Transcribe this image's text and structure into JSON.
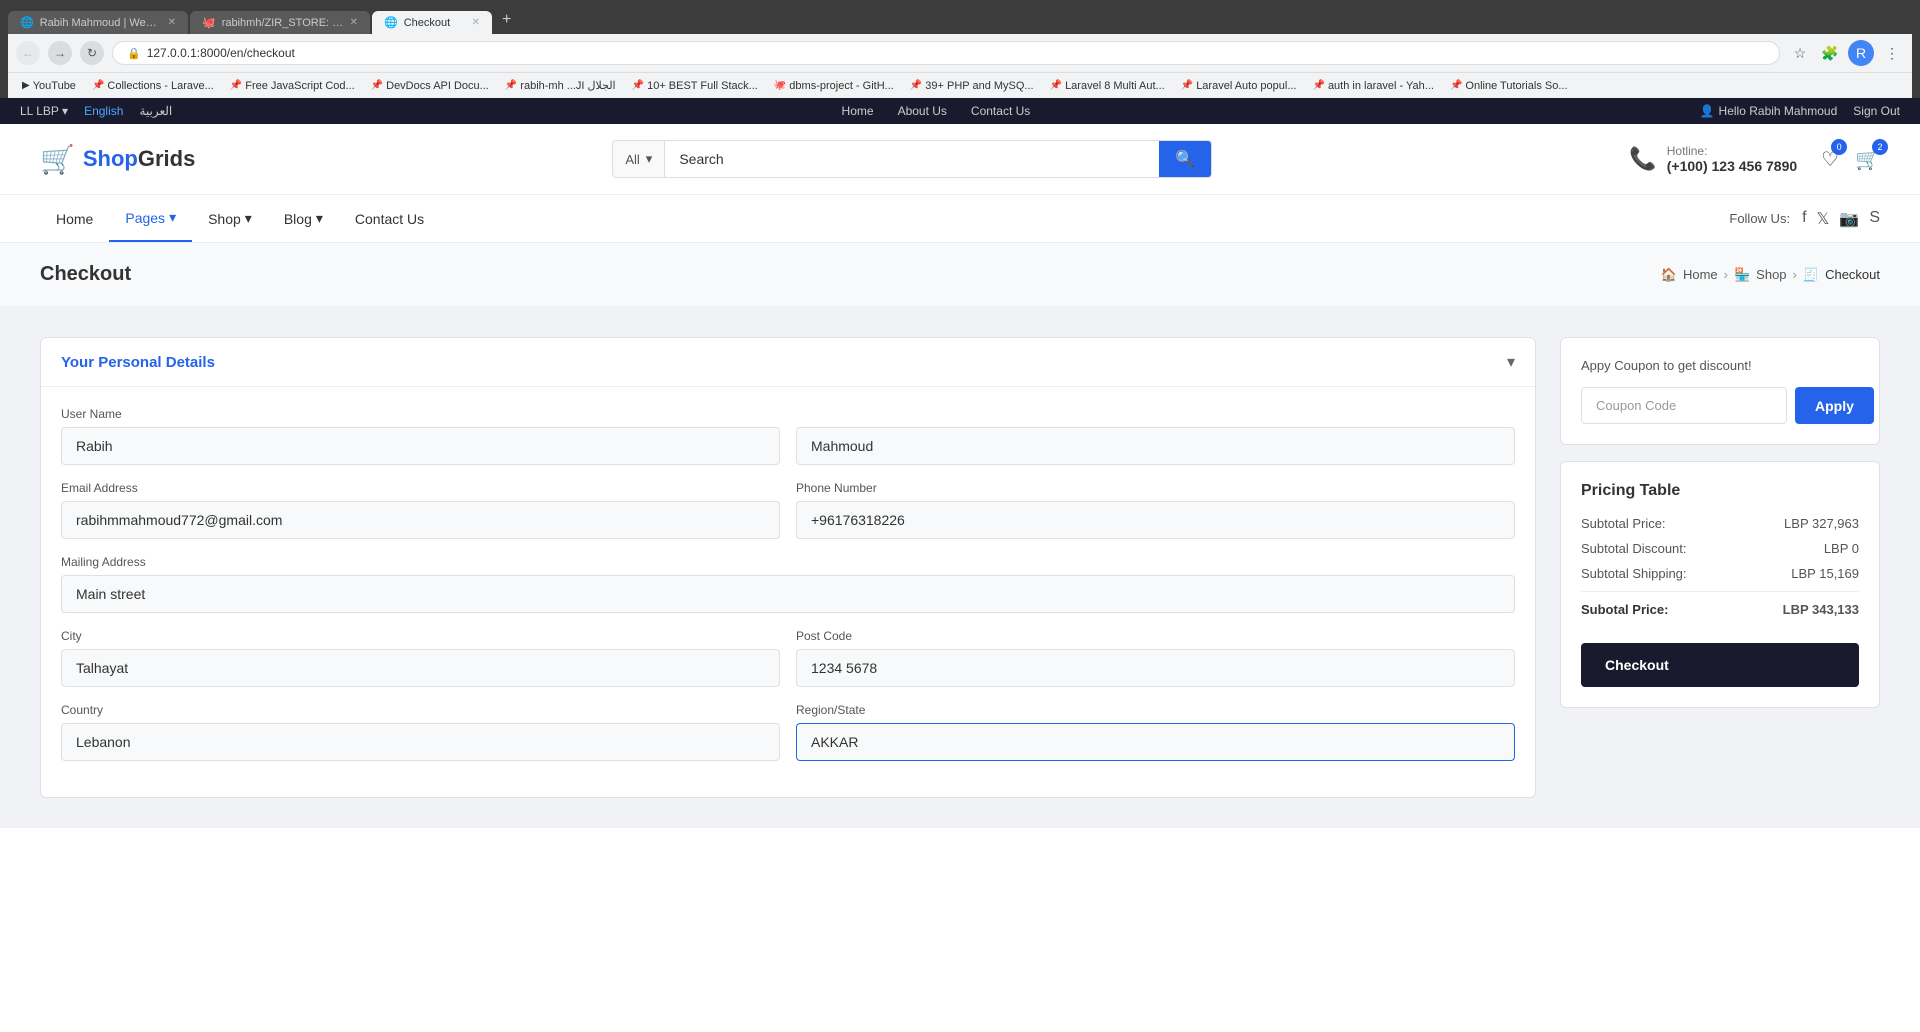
{
  "browser": {
    "tabs": [
      {
        "id": "tab1",
        "title": "Rabih Mahmoud | Web Develop...",
        "active": false,
        "favicon": "🌐"
      },
      {
        "id": "tab2",
        "title": "rabihmh/ZIR_STORE: Multi vend...",
        "active": false,
        "favicon": "🐙"
      },
      {
        "id": "tab3",
        "title": "Checkout",
        "active": true,
        "favicon": "🌐"
      }
    ],
    "new_tab_label": "+",
    "address": "127.0.0.1:8000/en/checkout",
    "bookmarks": [
      {
        "id": "bm1",
        "label": "YouTube",
        "icon": "▶"
      },
      {
        "id": "bm2",
        "label": "Collections - Larave...",
        "icon": "📌"
      },
      {
        "id": "bm3",
        "label": "Free JavaScript Cod...",
        "icon": "📌"
      },
      {
        "id": "bm4",
        "label": "DevDocs API Docu...",
        "icon": "📌"
      },
      {
        "id": "bm5",
        "label": "rabih-mh ...JI الجلال",
        "icon": "📌"
      },
      {
        "id": "bm6",
        "label": "10+ BEST Full Stack...",
        "icon": "📌"
      },
      {
        "id": "bm7",
        "label": "dbms-project - GitH...",
        "icon": "🐙"
      },
      {
        "id": "bm8",
        "label": "39+ PHP and MySQ...",
        "icon": "📌"
      },
      {
        "id": "bm9",
        "label": "Laravel 8 Multi Aut...",
        "icon": "📌"
      },
      {
        "id": "bm10",
        "label": "Laravel Auto popul...",
        "icon": "📌"
      },
      {
        "id": "bm11",
        "label": "auth in laravel - Yah...",
        "icon": "📌"
      },
      {
        "id": "bm12",
        "label": "Online Tutorials So...",
        "icon": "📌"
      }
    ]
  },
  "topbar": {
    "currency": "LL LBP",
    "currency_arrow": "▾",
    "lang_english": "English",
    "lang_arabic": "العربية",
    "nav_home": "Home",
    "nav_about": "About Us",
    "nav_contact": "Contact Us",
    "user_greeting": "Hello Rabih Mahmoud",
    "sign_out": "Sign Out",
    "user_icon": "👤"
  },
  "header": {
    "logo_shop": "Shop",
    "logo_grids": "Grids",
    "search_placeholder": "Search",
    "search_category": "All",
    "search_category_arrow": "▾",
    "hotline_label": "Hotline:",
    "hotline_number": "(+100) 123 456 7890",
    "wishlist_count": "0",
    "cart_count": "2"
  },
  "nav": {
    "items": [
      {
        "id": "home",
        "label": "Home",
        "active": false,
        "has_arrow": false
      },
      {
        "id": "pages",
        "label": "Pages",
        "active": true,
        "has_arrow": true
      },
      {
        "id": "shop",
        "label": "Shop",
        "active": false,
        "has_arrow": true
      },
      {
        "id": "blog",
        "label": "Blog",
        "active": false,
        "has_arrow": true
      },
      {
        "id": "contact",
        "label": "Contact Us",
        "active": false,
        "has_arrow": false
      }
    ],
    "follow_us_label": "Follow Us:",
    "social": [
      "f",
      "t",
      "📷",
      "S"
    ]
  },
  "breadcrumb": {
    "page_title": "Checkout",
    "items": [
      {
        "id": "home",
        "label": "Home",
        "is_link": true
      },
      {
        "id": "shop",
        "label": "Shop",
        "is_link": true
      },
      {
        "id": "checkout",
        "label": "Checkout",
        "is_link": false
      }
    ]
  },
  "form": {
    "section_title": "Your Personal Details",
    "user_name_label": "User Name",
    "first_name": "Rabih",
    "last_name": "Mahmoud",
    "email_label": "Email Address",
    "email_value": "rabihmmahmoud772@gmail.com",
    "phone_label": "Phone Number",
    "phone_value": "+96176318226",
    "address_label": "Mailing Address",
    "address_value": "Main street",
    "city_label": "City",
    "city_value": "Talhayat",
    "postcode_label": "Post Code",
    "postcode_value": "1234 5678",
    "country_label": "Country",
    "country_value": "Lebanon",
    "region_label": "Region/State",
    "region_value": "AKKAR"
  },
  "coupon": {
    "promo_text": "Appy Coupon to get discount!",
    "placeholder": "Coupon Code",
    "apply_label": "Apply"
  },
  "pricing": {
    "title": "Pricing Table",
    "subtotal_price_label": "Subtotal Price:",
    "subtotal_price_value": "LBP 327,963",
    "subtotal_discount_label": "Subtotal Discount:",
    "subtotal_discount_value": "LBP 0",
    "subtotal_shipping_label": "Subtotal Shipping:",
    "subtotal_shipping_value": "LBP 15,169",
    "total_label": "Subotal Price:",
    "total_value": "LBP 343,133",
    "checkout_btn": "Checkout"
  }
}
